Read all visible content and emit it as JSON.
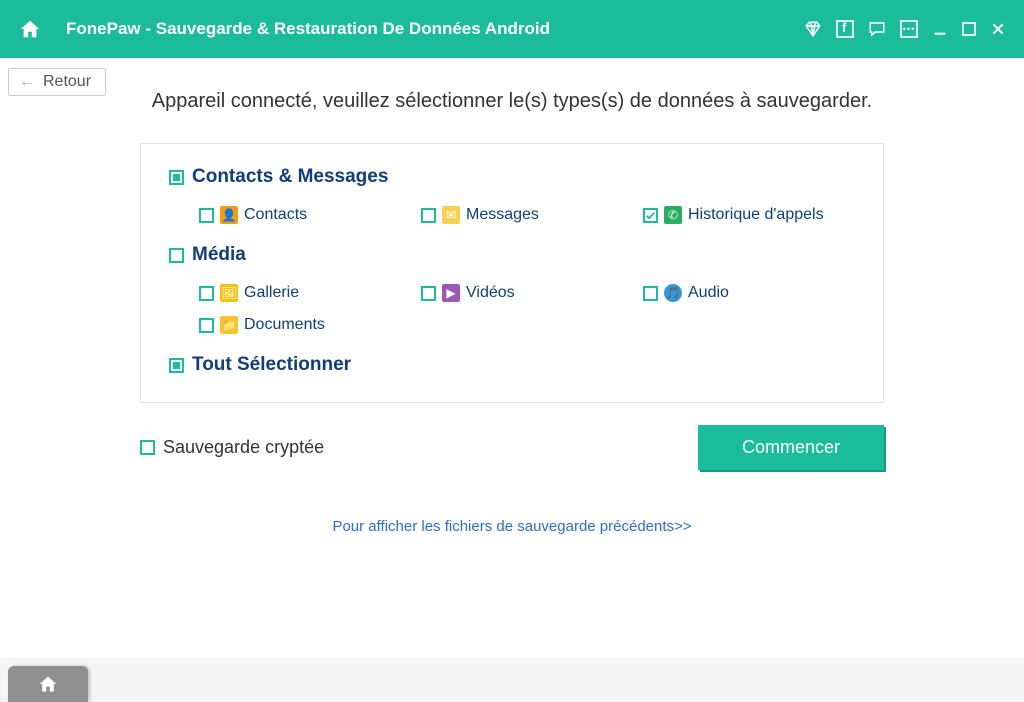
{
  "titlebar": {
    "title": "FonePaw - Sauvegarde & Restauration De Données Android"
  },
  "nav": {
    "back": "Retour"
  },
  "heading": "Appareil connecté, veuillez sélectionner le(s) types(s) de données à sauvegarder.",
  "categories": {
    "contacts_messages": {
      "label": "Contacts & Messages",
      "state": "partial"
    },
    "media": {
      "label": "Média",
      "state": "unchecked"
    },
    "select_all": {
      "label": "Tout Sélectionner",
      "state": "partial"
    }
  },
  "items": {
    "contacts": {
      "label": "Contacts",
      "checked": false,
      "icon_bg": "#f39c12",
      "glyph": "👤"
    },
    "messages": {
      "label": "Messages",
      "checked": false,
      "icon_bg": "#f7d154",
      "glyph": "✉"
    },
    "call_log": {
      "label": "Historique d'appels",
      "checked": true,
      "icon_bg": "#27ae60",
      "glyph": "✆"
    },
    "gallery": {
      "label": "Gallerie",
      "checked": false,
      "icon_bg": "#f1c40f",
      "glyph": "🖼"
    },
    "videos": {
      "label": "Vidéos",
      "checked": false,
      "icon_bg": "#9b59b6",
      "glyph": "▶"
    },
    "audio": {
      "label": "Audio",
      "checked": false,
      "icon_bg": "#3498db",
      "glyph": "🎵"
    },
    "documents": {
      "label": "Documents",
      "checked": false,
      "icon_bg": "#f4c430",
      "glyph": "📁"
    }
  },
  "footer": {
    "encrypt_label": "Sauvegarde cryptée",
    "encrypt_checked": false,
    "start_label": "Commencer",
    "history_link": "Pour afficher les fichiers de sauvegarde précédents>>"
  },
  "colors": {
    "accent": "#1abc9c",
    "link": "#2b6fc9",
    "heading": "#0f3f7a"
  }
}
